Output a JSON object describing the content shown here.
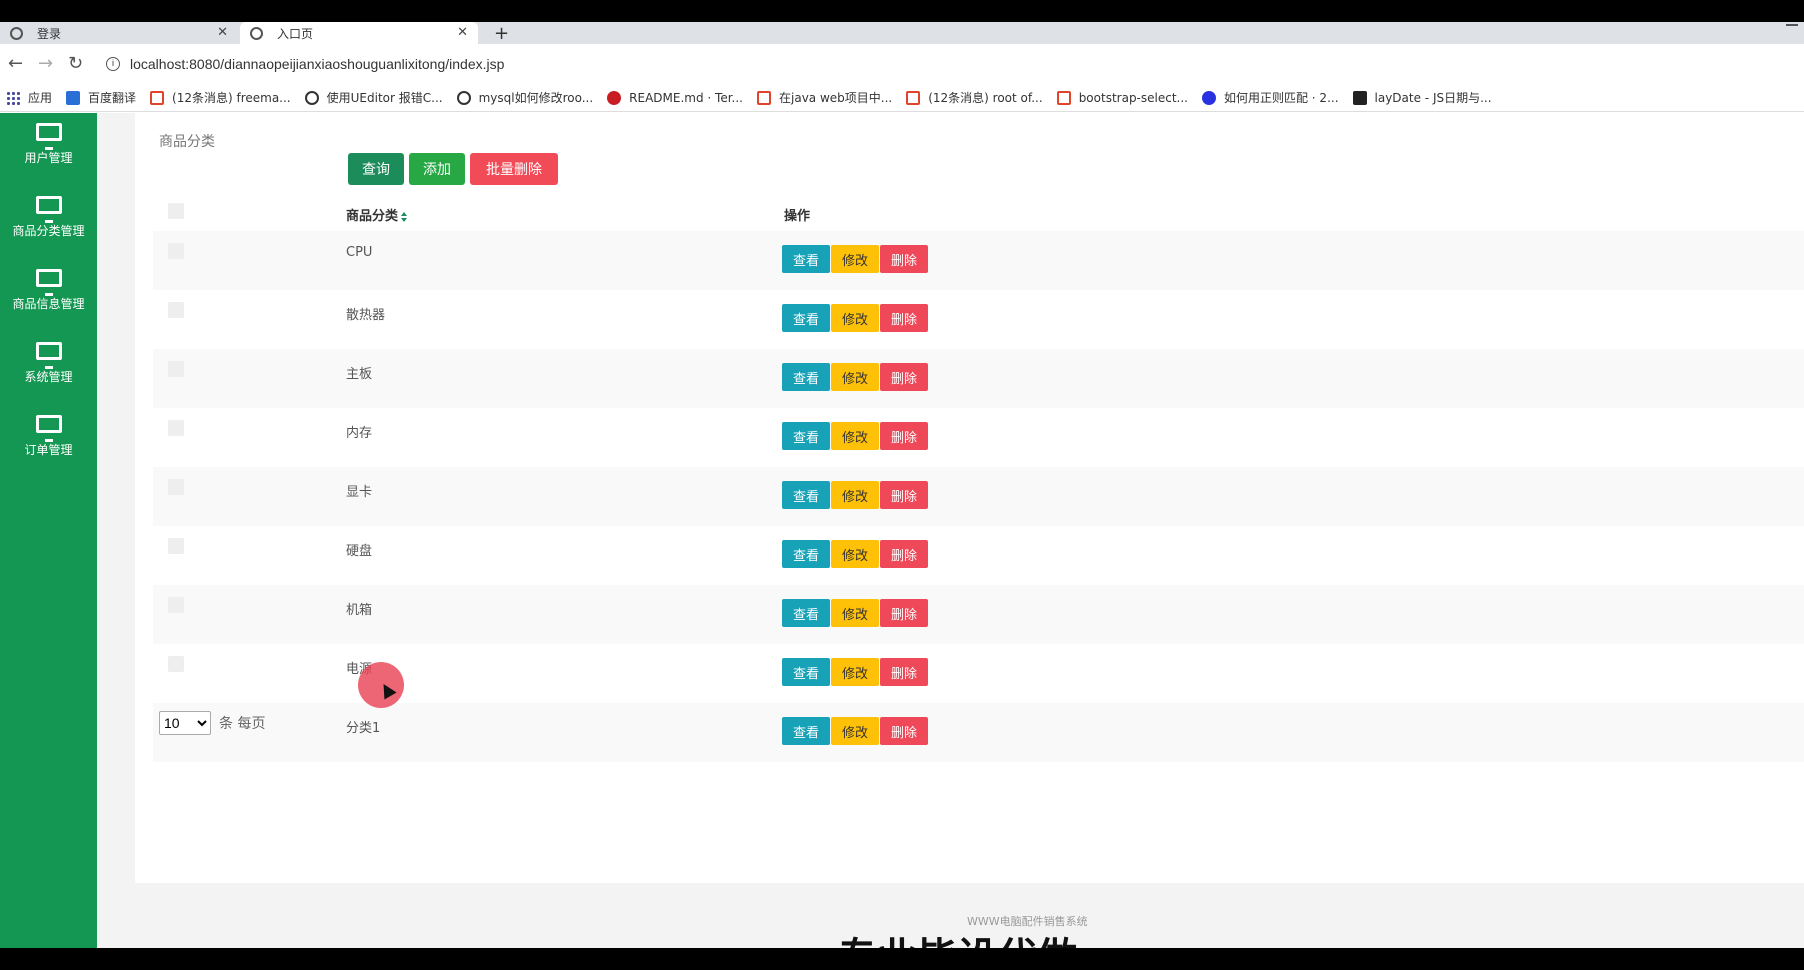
{
  "browser": {
    "tabs": [
      {
        "title": "登录"
      },
      {
        "title": "入口页"
      }
    ],
    "new_tab": "+",
    "url": "localhost:8080/diannaopeijianxiaoshouguanlixitong/index.jsp",
    "bookmarks": [
      {
        "label": "应用",
        "color": "#4a4a9a"
      },
      {
        "label": "百度翻译",
        "color": "#2a6fd6"
      },
      {
        "label": "(12条消息) freema...",
        "color": "#e0452b"
      },
      {
        "label": "使用UEditor 报错C...",
        "color": "#333333"
      },
      {
        "label": "mysql如何修改roo...",
        "color": "#333333"
      },
      {
        "label": "README.md · Ter...",
        "color": "#c71d23"
      },
      {
        "label": "在java web项目中...",
        "color": "#e0452b"
      },
      {
        "label": "(12条消息) root of...",
        "color": "#e0452b"
      },
      {
        "label": "bootstrap-select...",
        "color": "#e0452b"
      },
      {
        "label": "如何用正则匹配 · 2...",
        "color": "#2932e1"
      },
      {
        "label": "layDate - JS日期与...",
        "color": "#222222"
      }
    ]
  },
  "sidebar": {
    "items": [
      {
        "label": "用户管理"
      },
      {
        "label": "商品分类管理"
      },
      {
        "label": "商品信息管理"
      },
      {
        "label": "系统管理"
      },
      {
        "label": "订单管理"
      }
    ]
  },
  "main": {
    "breadcrumb": "商品分类",
    "toolbar": {
      "query": "查询",
      "add": "添加",
      "batch_delete": "批量删除"
    },
    "table": {
      "headers": {
        "name": "商品分类",
        "ops": "操作"
      },
      "rows": [
        {
          "name": "CPU"
        },
        {
          "name": "散热器"
        },
        {
          "name": "主板"
        },
        {
          "name": "内存"
        },
        {
          "name": "显卡"
        },
        {
          "name": "硬盘"
        },
        {
          "name": "机箱"
        },
        {
          "name": "电源"
        },
        {
          "name": "分类1"
        }
      ],
      "actions": {
        "view": "查看",
        "edit": "修改",
        "delete": "删除"
      }
    },
    "pager": {
      "page_size": "10",
      "suffix": "条 每页"
    }
  },
  "footer": {
    "big": "专业毕设代做",
    "small": "WWW电脑配件销售系统"
  },
  "colors": {
    "sidebar": "#149753",
    "primary": "#1b8c5a",
    "danger": "#ef4858",
    "warning": "#ffc107",
    "info": "#17a2b8"
  }
}
